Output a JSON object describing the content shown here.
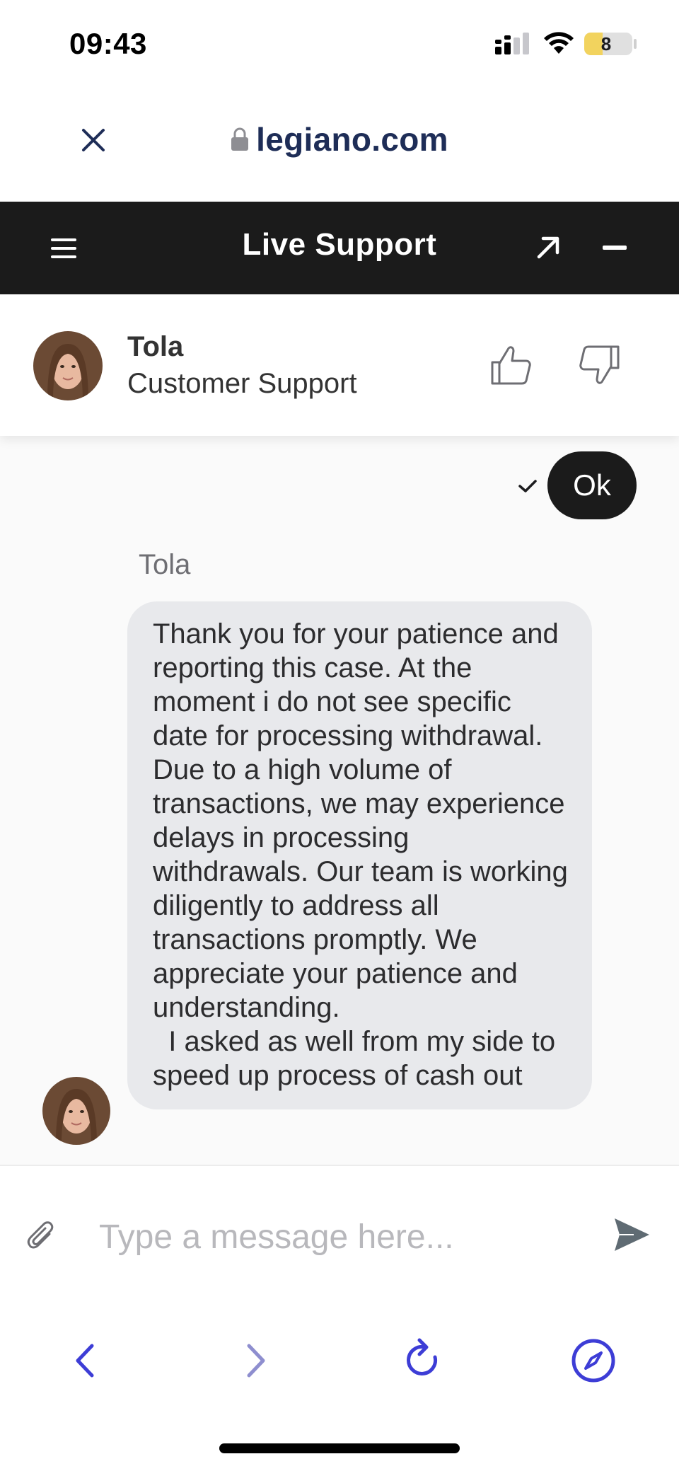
{
  "status_bar": {
    "time": "09:43",
    "battery_level": "8",
    "battery_fraction": 0.08,
    "icons": [
      "signal-icon",
      "wifi-icon",
      "battery-icon"
    ]
  },
  "browser": {
    "url": "legiano.com",
    "close_icon": "close-icon",
    "lock_icon": "lock-icon"
  },
  "support_header": {
    "title": "Live Support",
    "icons": [
      "menu-icon",
      "expand-icon",
      "minimize-icon"
    ]
  },
  "agent": {
    "name": "Tola",
    "role": "Customer Support",
    "rating_icons": [
      "thumbs-up-icon",
      "thumbs-down-icon"
    ]
  },
  "messages": {
    "user_message": "Ok",
    "agent_sender": "Tola",
    "agent_message": "Thank you for your patience and reporting this case. At the moment i do not see specific date for processing withdrawal. Due to a high volume of transactions, we may experience delays in processing withdrawals. Our team is working diligently to address all transactions promptly. We appreciate your patience and understanding.\n  I asked as well from my side to speed up process of cash out"
  },
  "composer": {
    "placeholder": "Type a message here...",
    "value": ""
  },
  "colors": {
    "header_bg": "#1b1b1b",
    "url_text": "#1e2d57",
    "agent_bubble": "#e8e9ec",
    "user_bubble": "#1b1b1b",
    "toolbar_accent": "#3d3dd6",
    "toolbar_disabled": "#8e8ecf"
  },
  "toolbar": {
    "icons": [
      "back-icon",
      "forward-icon",
      "reload-icon",
      "compass-icon"
    ]
  }
}
